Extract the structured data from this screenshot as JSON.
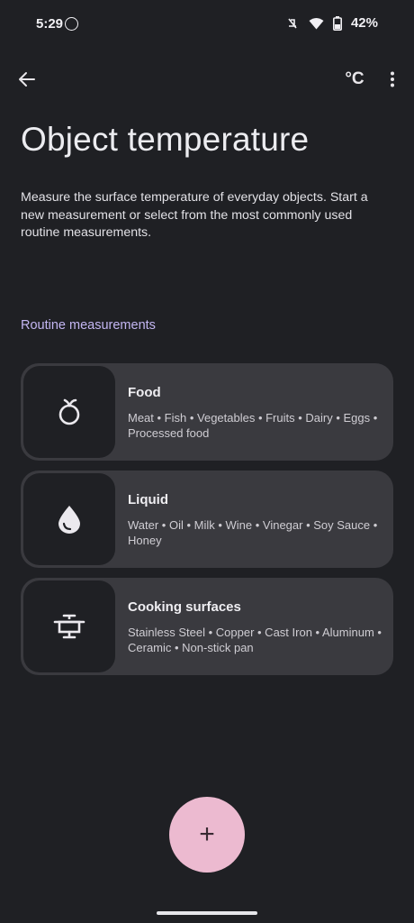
{
  "status_bar": {
    "time": "5:29",
    "battery_percent": "42%",
    "icons": [
      "whatsapp-icon",
      "mute-icon",
      "wifi-icon",
      "battery-icon"
    ]
  },
  "top_bar": {
    "back_icon": "arrow-left-icon",
    "unit_label": "°C",
    "more_icon": "more-vert-icon"
  },
  "page": {
    "title": "Object temperature",
    "description": "Measure the surface temperature of everyday objects. Start a new measurement or select from the most commonly used routine measurements."
  },
  "routine": {
    "section_label": "Routine measurements",
    "items": [
      {
        "title": "Food",
        "subtitle": "Meat • Fish • Vegetables • Fruits • Dairy • Eggs • Processed food",
        "icon": "apple-icon"
      },
      {
        "title": "Liquid",
        "subtitle": "Water • Oil • Milk • Wine • Vinegar • Soy Sauce • Honey",
        "icon": "droplet-icon"
      },
      {
        "title": "Cooking surfaces",
        "subtitle": "Stainless Steel • Copper • Cast Iron • Aluminum • Ceramic • Non-stick pan",
        "icon": "cooking-pot-icon"
      }
    ]
  },
  "fab": {
    "label": "+",
    "icon": "add-icon"
  },
  "colors": {
    "background": "#1f2024",
    "card": "#3a3a3f",
    "accent_label": "#c3b6f2",
    "fab": "#ecbad0"
  }
}
